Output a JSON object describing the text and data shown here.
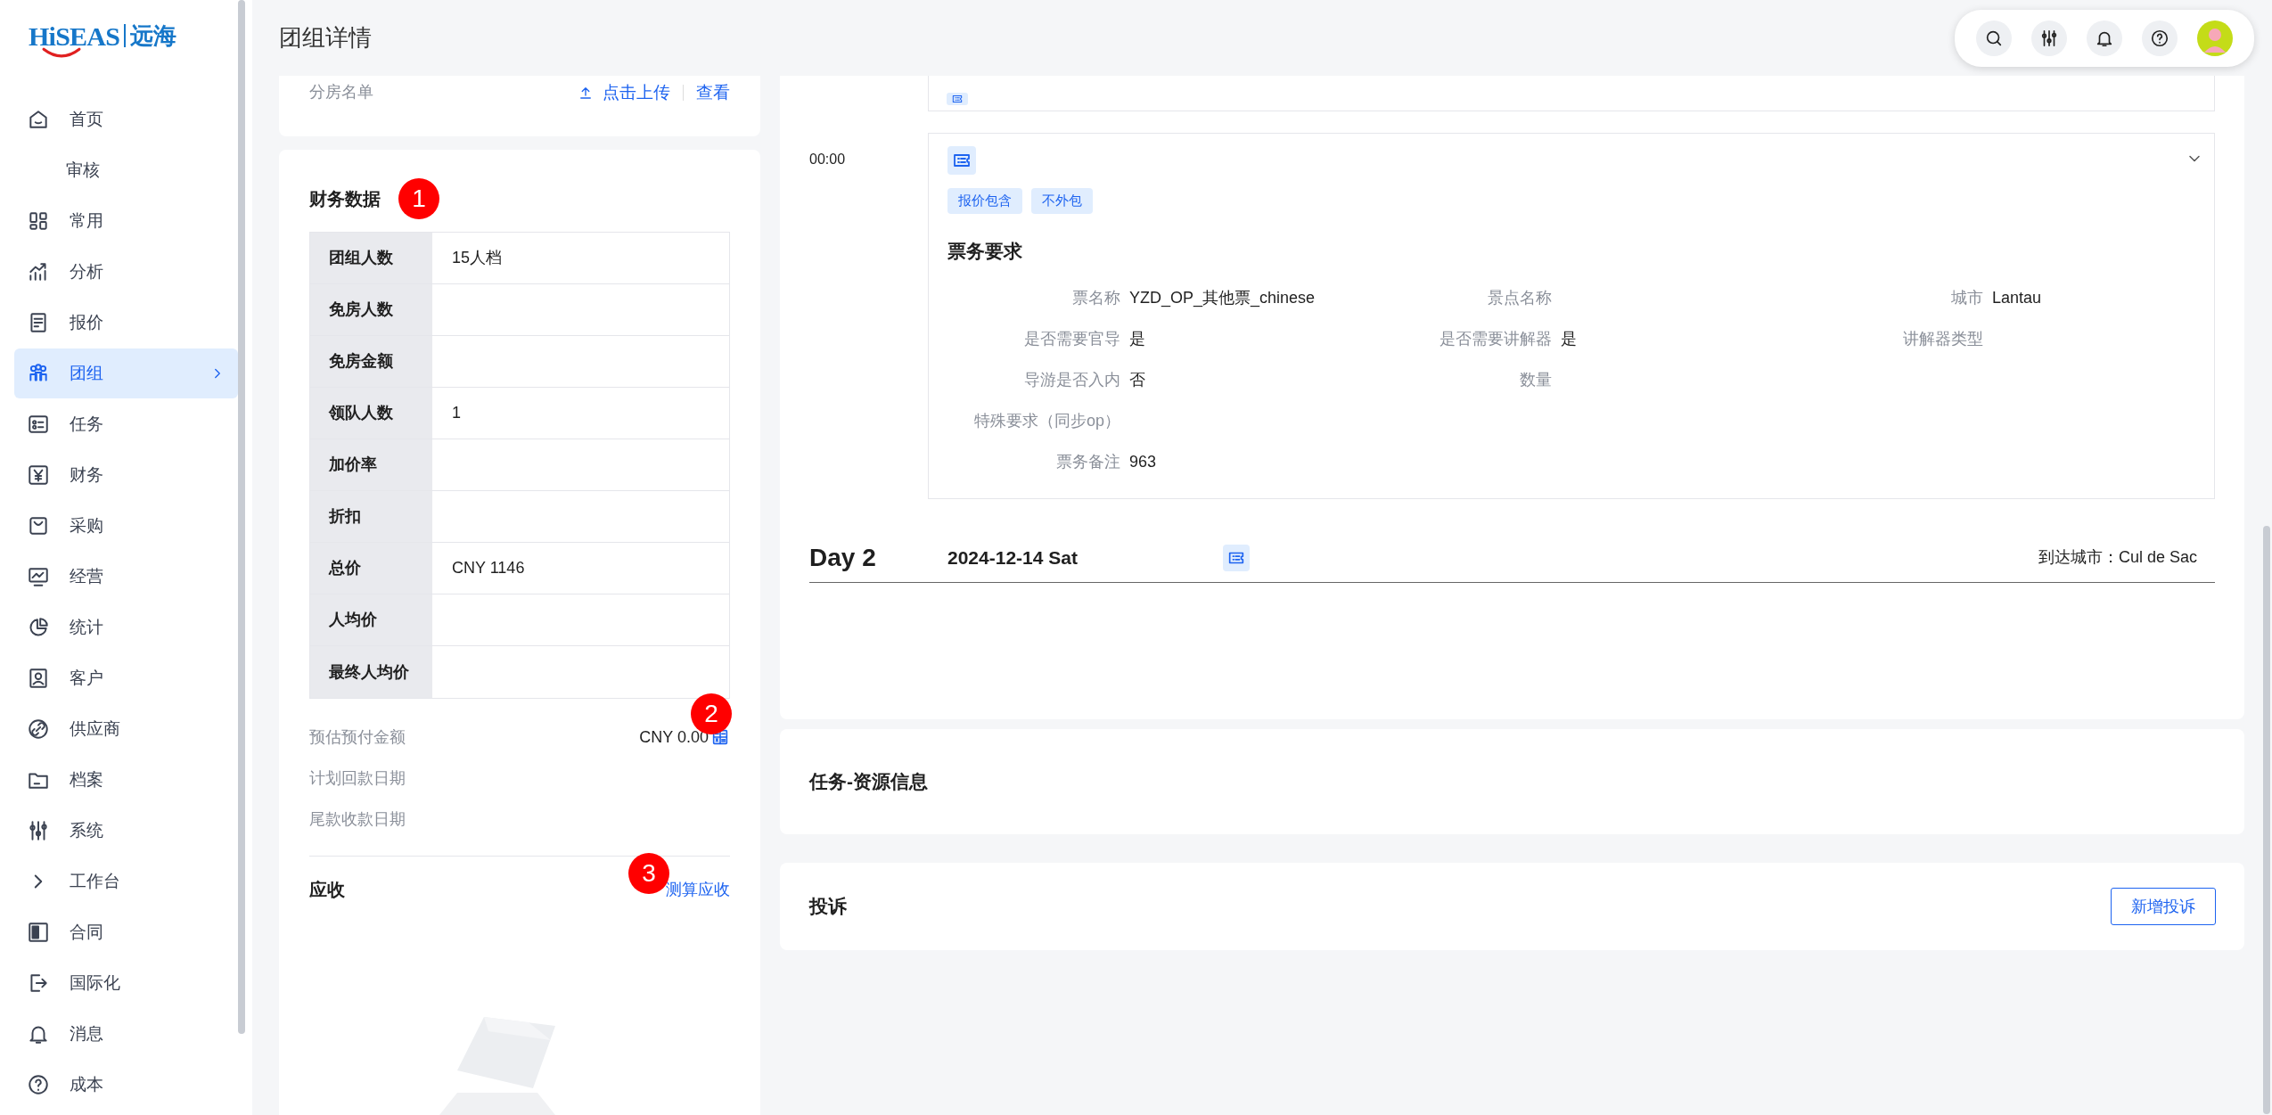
{
  "logo": {
    "brand": "HiSEAS",
    "name": "远海"
  },
  "sidebar": {
    "items": [
      {
        "label": "首页",
        "selected": false,
        "submenu": false
      },
      {
        "label": "审核",
        "selected": false,
        "submenu": false
      },
      {
        "label": "常用",
        "selected": false,
        "submenu": false
      },
      {
        "label": "分析",
        "selected": false,
        "submenu": false
      },
      {
        "label": "报价",
        "selected": false,
        "submenu": false
      },
      {
        "label": "团组",
        "selected": true,
        "submenu": true
      },
      {
        "label": "任务",
        "selected": false,
        "submenu": false
      },
      {
        "label": "财务",
        "selected": false,
        "submenu": false
      },
      {
        "label": "采购",
        "selected": false,
        "submenu": false
      },
      {
        "label": "经营",
        "selected": false,
        "submenu": false
      },
      {
        "label": "统计",
        "selected": false,
        "submenu": false
      },
      {
        "label": "客户",
        "selected": false,
        "submenu": false
      },
      {
        "label": "供应商",
        "selected": false,
        "submenu": false
      },
      {
        "label": "档案",
        "selected": false,
        "submenu": false
      },
      {
        "label": "系统",
        "selected": false,
        "submenu": false
      },
      {
        "label": "工作台",
        "selected": false,
        "submenu": false
      },
      {
        "label": "合同",
        "selected": false,
        "submenu": false
      },
      {
        "label": "国际化",
        "selected": false,
        "submenu": false
      },
      {
        "label": "消息",
        "selected": false,
        "submenu": false
      },
      {
        "label": "成本",
        "selected": false,
        "submenu": false
      }
    ]
  },
  "header": {
    "title": "团组详情"
  },
  "room_list": {
    "label": "分房名单",
    "upload": "点击上传",
    "view": "查看"
  },
  "finance": {
    "title": "财务数据",
    "marker": "1",
    "rows": [
      {
        "label": "团组人数",
        "value": "15人档"
      },
      {
        "label": "免房人数"
      },
      {
        "label": "免房金额"
      },
      {
        "label": "领队人数",
        "value": "1"
      },
      {
        "label": "加价率"
      },
      {
        "label": "折扣"
      },
      {
        "label": "总价",
        "value": "CNY 1146"
      },
      {
        "label": "人均价"
      },
      {
        "label": "最终人均价"
      }
    ],
    "prepay": {
      "label": "预估预付金额",
      "value": "CNY 0.00",
      "marker": "2"
    },
    "dates": [
      "计划回款日期",
      "尾款收款日期"
    ],
    "receivable": {
      "title": "应收",
      "action": "测算应收",
      "marker": "3"
    }
  },
  "itinerary": {
    "item": {
      "time": "00:00",
      "tags": [
        "报价包含",
        "不外包"
      ],
      "section_title": "票务要求",
      "rows": [
        [
          {
            "label": "票名称",
            "value": "YZD_OP_其他票_chinese"
          },
          {
            "label": "景点名称"
          },
          {
            "label": "城市",
            "value": "Lantau"
          }
        ],
        [
          {
            "label": "是否需要官导",
            "value": "是"
          },
          {
            "label": "是否需要讲解器",
            "value": "是"
          },
          {
            "label": "讲解器类型"
          }
        ],
        [
          {
            "label": "导游是否入内",
            "value": "否"
          },
          {
            "label": "数量"
          }
        ],
        [
          {
            "label": "特殊要求（同步op）"
          }
        ],
        [
          {
            "label": "票务备注",
            "value": "963"
          }
        ]
      ]
    },
    "day": {
      "label": "Day 2",
      "date": "2024-12-14 Sat",
      "arrival": "到达城市：Cul de Sac"
    }
  },
  "resource": {
    "title": "任务-资源信息"
  },
  "complaints": {
    "title": "投诉",
    "button": "新增投诉"
  }
}
